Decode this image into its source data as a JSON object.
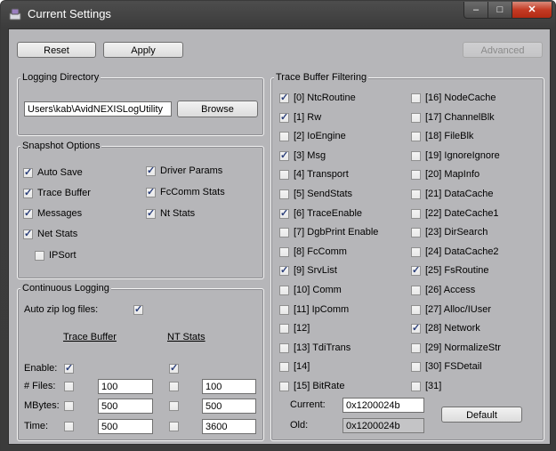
{
  "window": {
    "title": "Current Settings",
    "min": "–",
    "max": "□",
    "close": "✕"
  },
  "toolbar": {
    "reset": "Reset",
    "apply": "Apply",
    "advanced": "Advanced"
  },
  "logging_dir": {
    "title": "Logging Directory",
    "path": "Users\\kab\\AvidNEXISLogUtility",
    "browse": "Browse"
  },
  "snapshot": {
    "title": "Snapshot Options",
    "left": [
      {
        "label": "Auto Save",
        "checked": true
      },
      {
        "label": "Trace Buffer",
        "checked": true
      },
      {
        "label": "Messages",
        "checked": true
      },
      {
        "label": "Net Stats",
        "checked": true
      }
    ],
    "ipsort": {
      "label": "IPSort",
      "checked": false
    },
    "right": [
      {
        "label": "Driver Params",
        "checked": true
      },
      {
        "label": "FcComm Stats",
        "checked": true
      },
      {
        "label": "Nt Stats",
        "checked": true
      }
    ]
  },
  "continuous": {
    "title": "Continuous Logging",
    "auto_zip": "Auto zip log files:",
    "auto_zip_checked": true,
    "col_trace": "Trace Buffer",
    "col_nt": "NT Stats",
    "rows": [
      {
        "label": "Enable:",
        "trace_checked": true,
        "nt_checked": true
      },
      {
        "label": "# Files:",
        "trace_checked": false,
        "trace_value": "100",
        "nt_checked": false,
        "nt_value": "100"
      },
      {
        "label": "MBytes:",
        "trace_checked": false,
        "trace_value": "500",
        "nt_checked": false,
        "nt_value": "500"
      },
      {
        "label": "Time:",
        "trace_checked": false,
        "trace_value": "500",
        "nt_checked": false,
        "nt_value": "3600"
      }
    ]
  },
  "trace_filter": {
    "title": "Trace Buffer Filtering",
    "left": [
      {
        "label": "[0] NtcRoutine",
        "checked": true
      },
      {
        "label": "[1] Rw",
        "checked": true
      },
      {
        "label": "[2] IoEngine",
        "checked": false
      },
      {
        "label": "[3] Msg",
        "checked": true
      },
      {
        "label": "[4] Transport",
        "checked": false
      },
      {
        "label": "[5] SendStats",
        "checked": false
      },
      {
        "label": "[6] TraceEnable",
        "checked": true
      },
      {
        "label": "[7] DgbPrint Enable",
        "checked": false
      },
      {
        "label": "[8] FcComm",
        "checked": false
      },
      {
        "label": "[9] SrvList",
        "checked": true
      },
      {
        "label": "[10] Comm",
        "checked": false
      },
      {
        "label": "[11] IpComm",
        "checked": false
      },
      {
        "label": "[12]",
        "checked": false
      },
      {
        "label": "[13] TdiTrans",
        "checked": false
      },
      {
        "label": "[14]",
        "checked": false
      },
      {
        "label": "[15] BitRate",
        "checked": false
      }
    ],
    "right": [
      {
        "label": "[16] NodeCache",
        "checked": false
      },
      {
        "label": "[17] ChannelBlk",
        "checked": false
      },
      {
        "label": "[18] FileBlk",
        "checked": false
      },
      {
        "label": "[19] IgnoreIgnore",
        "checked": false
      },
      {
        "label": "[20] MapInfo",
        "checked": false
      },
      {
        "label": "[21] DataCache",
        "checked": false
      },
      {
        "label": "[22] DateCache1",
        "checked": false
      },
      {
        "label": "[23] DirSearch",
        "checked": false
      },
      {
        "label": "[24] DataCache2",
        "checked": false
      },
      {
        "label": "[25] FsRoutine",
        "checked": true
      },
      {
        "label": "[26] Access",
        "checked": false
      },
      {
        "label": "[27] Alloc/IUser",
        "checked": false
      },
      {
        "label": "[28] Network",
        "checked": true
      },
      {
        "label": "[29] NormalizeStr",
        "checked": false
      },
      {
        "label": "[30] FSDetail",
        "checked": false
      },
      {
        "label": "[31]",
        "checked": false
      }
    ],
    "current_label": "Current:",
    "current_value": "0x1200024b",
    "old_label": "Old:",
    "old_value": "0x1200024b",
    "default": "Default"
  }
}
